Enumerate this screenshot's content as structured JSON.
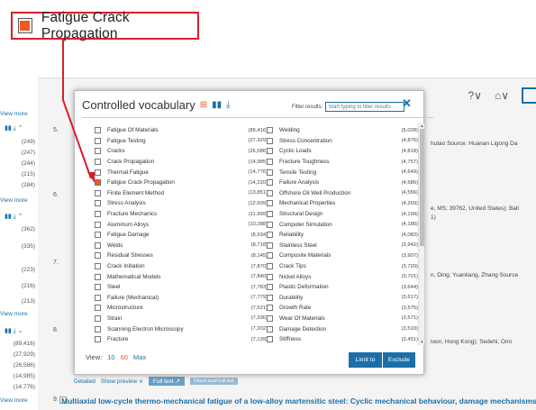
{
  "callout": {
    "label": "Fatigue Crack Propagation"
  },
  "header": {
    "help_icon": "?∨",
    "library_icon": "⌂∨"
  },
  "sidebar": {
    "view_more_labels": [
      "View more",
      "View more",
      "View more",
      "View more"
    ],
    "counts_a": [
      "(249)",
      "(247)",
      "(244)",
      "(215)",
      "(284)"
    ],
    "counts_b": [
      "(362)",
      "(335)",
      "(223)",
      "(216)",
      "(213)"
    ],
    "counts_c": [
      "(89,416)",
      "(27,929)",
      "(26,586)",
      "(14,985)",
      "(14,776)"
    ]
  },
  "results": {
    "numbers": [
      "5.",
      "6.",
      "7.",
      "8.",
      "9."
    ],
    "snippet_1": "hutao Source: Huanan Ligong Da",
    "snippet_2": "e, MS; 39762, United States); Ball",
    "snippet_2b": "1)",
    "snippet_3": "n, Ding; Yuanliang, Zhang Source",
    "snippet_4": "loon, Hong Kong); Sedehi, Omi",
    "detailed": "Detailed",
    "show_preview": "Show preview ∨",
    "full_text": "Full text ↗",
    "check_local": "Check local Full text",
    "title_9": "Multiaxial low-cycle thermo-mechanical fatigue of a low-alloy martensitic steel: Cyclic mechanical behaviour, damage mechanisms a"
  },
  "modal": {
    "title": "Controlled vocabulary",
    "filter_label": "Filter results:",
    "filter_placeholder": "Start typing to filter results",
    "close": "✕",
    "col1": [
      {
        "label": "Fatigue Of Materials",
        "count": "(89,416)",
        "checked": false
      },
      {
        "label": "Fatigue Testing",
        "count": "(27,929)",
        "checked": false
      },
      {
        "label": "Cracks",
        "count": "(26,586)",
        "checked": false
      },
      {
        "label": "Crack Propagation",
        "count": "(14,985)",
        "checked": false
      },
      {
        "label": "Thermal Fatigue",
        "count": "(14,776)",
        "checked": false
      },
      {
        "label": "Fatigue Crack Propagation",
        "count": "(14,220)",
        "checked": true
      },
      {
        "label": "Finite Element Method",
        "count": "(13,851)",
        "checked": false
      },
      {
        "label": "Stress Analysis",
        "count": "(12,609)",
        "checked": false
      },
      {
        "label": "Fracture Mechanics",
        "count": "(11,999)",
        "checked": false
      },
      {
        "label": "Aluminum Alloys",
        "count": "(10,288)",
        "checked": false
      },
      {
        "label": "Fatigue Damage",
        "count": "(8,934)",
        "checked": false
      },
      {
        "label": "Welds",
        "count": "(8,718)",
        "checked": false
      },
      {
        "label": "Residual Stresses",
        "count": "(8,145)",
        "checked": false
      },
      {
        "label": "Crack Initiation",
        "count": "(7,870)",
        "checked": false
      },
      {
        "label": "Mathematical Models",
        "count": "(7,840)",
        "checked": false
      },
      {
        "label": "Steel",
        "count": "(7,783)",
        "checked": false
      },
      {
        "label": "Failure (Mechanical)",
        "count": "(7,779)",
        "checked": false
      },
      {
        "label": "Microstructure",
        "count": "(7,521)",
        "checked": false
      },
      {
        "label": "Strain",
        "count": "(7,336)",
        "checked": false
      },
      {
        "label": "Scanning Electron Microscopy",
        "count": "(7,202)",
        "checked": false
      },
      {
        "label": "Fracture",
        "count": "(7,139)",
        "checked": false
      }
    ],
    "col2": [
      {
        "label": "Welding",
        "count": "(5,028)",
        "checked": false
      },
      {
        "label": "Stress Concentration",
        "count": "(4,876)",
        "checked": false
      },
      {
        "label": "Cyclic Loads",
        "count": "(4,818)",
        "checked": false
      },
      {
        "label": "Fracture Toughness",
        "count": "(4,757)",
        "checked": false
      },
      {
        "label": "Tensile Testing",
        "count": "(4,649)",
        "checked": false
      },
      {
        "label": "Failure Analysis",
        "count": "(4,586)",
        "checked": false
      },
      {
        "label": "Offshore Oil Well Production",
        "count": "(4,556)",
        "checked": false
      },
      {
        "label": "Mechanical Properties",
        "count": "(4,269)",
        "checked": false
      },
      {
        "label": "Structural Design",
        "count": "(4,199)",
        "checked": false
      },
      {
        "label": "Computer Simulation",
        "count": "(4,186)",
        "checked": false
      },
      {
        "label": "Reliability",
        "count": "(4,082)",
        "checked": false
      },
      {
        "label": "Stainless Steel",
        "count": "(3,942)",
        "checked": false
      },
      {
        "label": "Composite Materials",
        "count": "(3,907)",
        "checked": false
      },
      {
        "label": "Crack Tips",
        "count": "(3,720)",
        "checked": false
      },
      {
        "label": "Nickel Alloys",
        "count": "(3,701)",
        "checked": false
      },
      {
        "label": "Plastic Deformation",
        "count": "(3,644)",
        "checked": false
      },
      {
        "label": "Durability",
        "count": "(3,617)",
        "checked": false
      },
      {
        "label": "Growth Rate",
        "count": "(3,575)",
        "checked": false
      },
      {
        "label": "Wear Of Materials",
        "count": "(3,571)",
        "checked": false
      },
      {
        "label": "Damage Detection",
        "count": "(3,510)",
        "checked": false
      },
      {
        "label": "Stiffness",
        "count": "(3,451)",
        "checked": false
      }
    ],
    "view_label": "View:",
    "view_options": [
      "10",
      "60",
      "Max"
    ],
    "limit_button": "Limit to",
    "exclude_button": "Exclude"
  },
  "colors": {
    "accent": "#f05a22",
    "link": "#1a6fa8",
    "callout": "#d9202a"
  }
}
